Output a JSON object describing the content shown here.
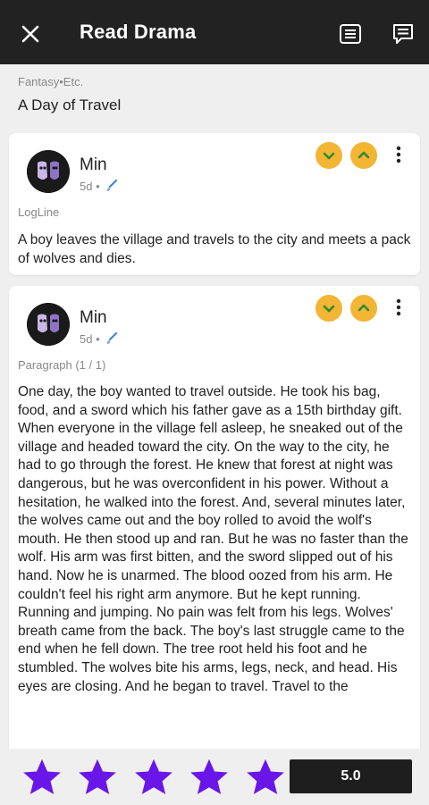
{
  "header": {
    "title": "Read Drama",
    "icons": [
      "close-icon",
      "list-icon",
      "comment-icon"
    ]
  },
  "story": {
    "genre": "Fantasy•Etc.",
    "title": "A Day of Travel"
  },
  "cards": [
    {
      "author": "Min",
      "time": "5d •",
      "section": "LogLine",
      "text": "A boy leaves the village and travels to the city and meets a pack of wolves and dies."
    },
    {
      "author": "Min",
      "time": "5d •",
      "section": "Paragraph (1 / 1)",
      "text": "One day, the boy wanted to travel outside. He took his bag, food, and a sword which his father gave as a 15th birthday gift. When everyone in the village fell asleep, he sneaked out of the village and headed toward the city. On the way to the city, he had to go through the forest. He knew that forest at night was dangerous, but he was overconfident in his power. Without a hesitation, he walked into the forest. And, several minutes later, the wolves came out and the boy rolled to avoid the wolf's mouth. He then stood up and ran. But he was no faster than the wolf. His arm was first bitten, and the sword slipped out of his hand. Now he is unarmed. The blood oozed from his arm. He couldn't feel his right arm anymore. But he kept running. Running and jumping. No pain was felt from his legs. Wolves' breath came from the back. The boy's last struggle came to the end when he fell down. The tree root held his foot and he stumbled. The wolves bite his arms, legs, neck, and head. His eyes are closing. And he began to travel. Travel to the"
    }
  ],
  "rating": {
    "stars_filled": 5,
    "stars_total": 5,
    "score": "5.0"
  },
  "colors": {
    "header_bg": "#222222",
    "vote_yellow": "#f2b534",
    "vote_arrow_green": "#2f8a2f",
    "star_purple": "#6a16e8",
    "score_bg": "#1e1e1e"
  }
}
